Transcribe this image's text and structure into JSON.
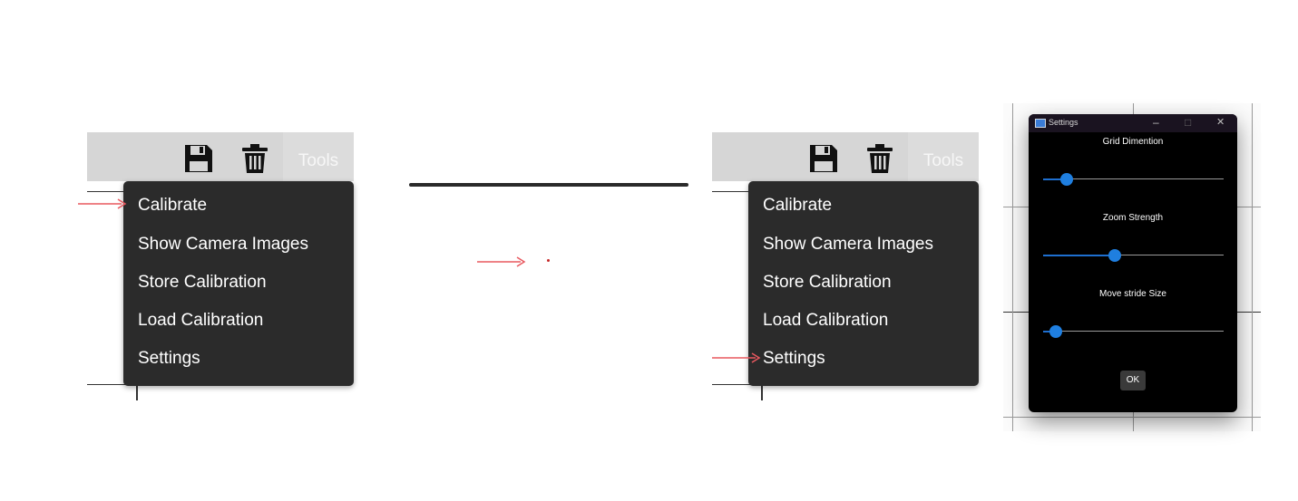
{
  "panel_left": {
    "tools_label": "Tools",
    "menu_items": [
      "Calibrate",
      "Show Camera Images",
      "Store Calibration",
      "Load Calibration",
      "Settings"
    ]
  },
  "panel_right": {
    "tools_label": "Tools",
    "menu_items": [
      "Calibrate",
      "Show Camera Images",
      "Store Calibration",
      "Load Calibration",
      "Settings"
    ]
  },
  "settings_dialog": {
    "title": "Settings",
    "minimize_glyph": "–",
    "maximize_glyph": "□",
    "close_glyph": "✕",
    "sliders": [
      {
        "label": "Grid Dimention",
        "value_fraction": 0.1
      },
      {
        "label": "Zoom Strength",
        "value_fraction": 0.39
      },
      {
        "label": "Move stride Size",
        "value_fraction": 0.04
      }
    ],
    "ok_label": "OK"
  },
  "colors": {
    "arrow": "#e8585f",
    "menu_bg": "#2b2b2b",
    "slider_accent": "#1f7fe0"
  },
  "icons": [
    "save-icon",
    "trash-icon",
    "right-arrow",
    "app-icon"
  ]
}
